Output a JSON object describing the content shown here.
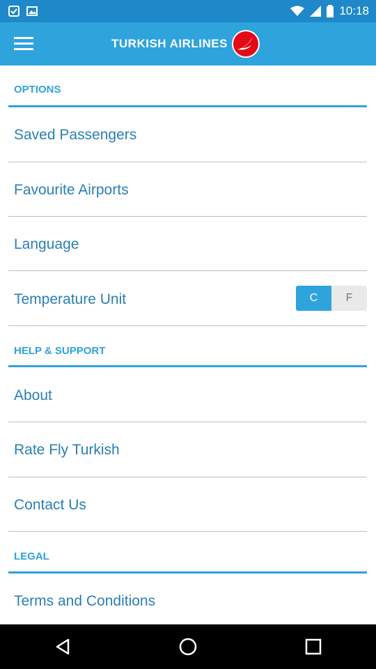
{
  "status_bar": {
    "time": "10:18",
    "battery_label": ""
  },
  "header": {
    "logo_text": "TURKISH AIRLINES"
  },
  "sections": {
    "options": {
      "title": "OPTIONS",
      "items": [
        "Saved Passengers",
        "Favourite Airports",
        "Language",
        "Temperature Unit"
      ],
      "temperature": {
        "celsius": "C",
        "fahrenheit": "F",
        "selected": "C"
      }
    },
    "help": {
      "title": "HELP & SUPPORT",
      "items": [
        "About",
        "Rate Fly Turkish",
        "Contact Us"
      ]
    },
    "legal": {
      "title": "LEGAL",
      "items": [
        "Terms and Conditions"
      ]
    }
  },
  "colors": {
    "accent": "#2ea3dc",
    "status_bar": "#1e88c8",
    "item_text": "#2a7fb3"
  }
}
